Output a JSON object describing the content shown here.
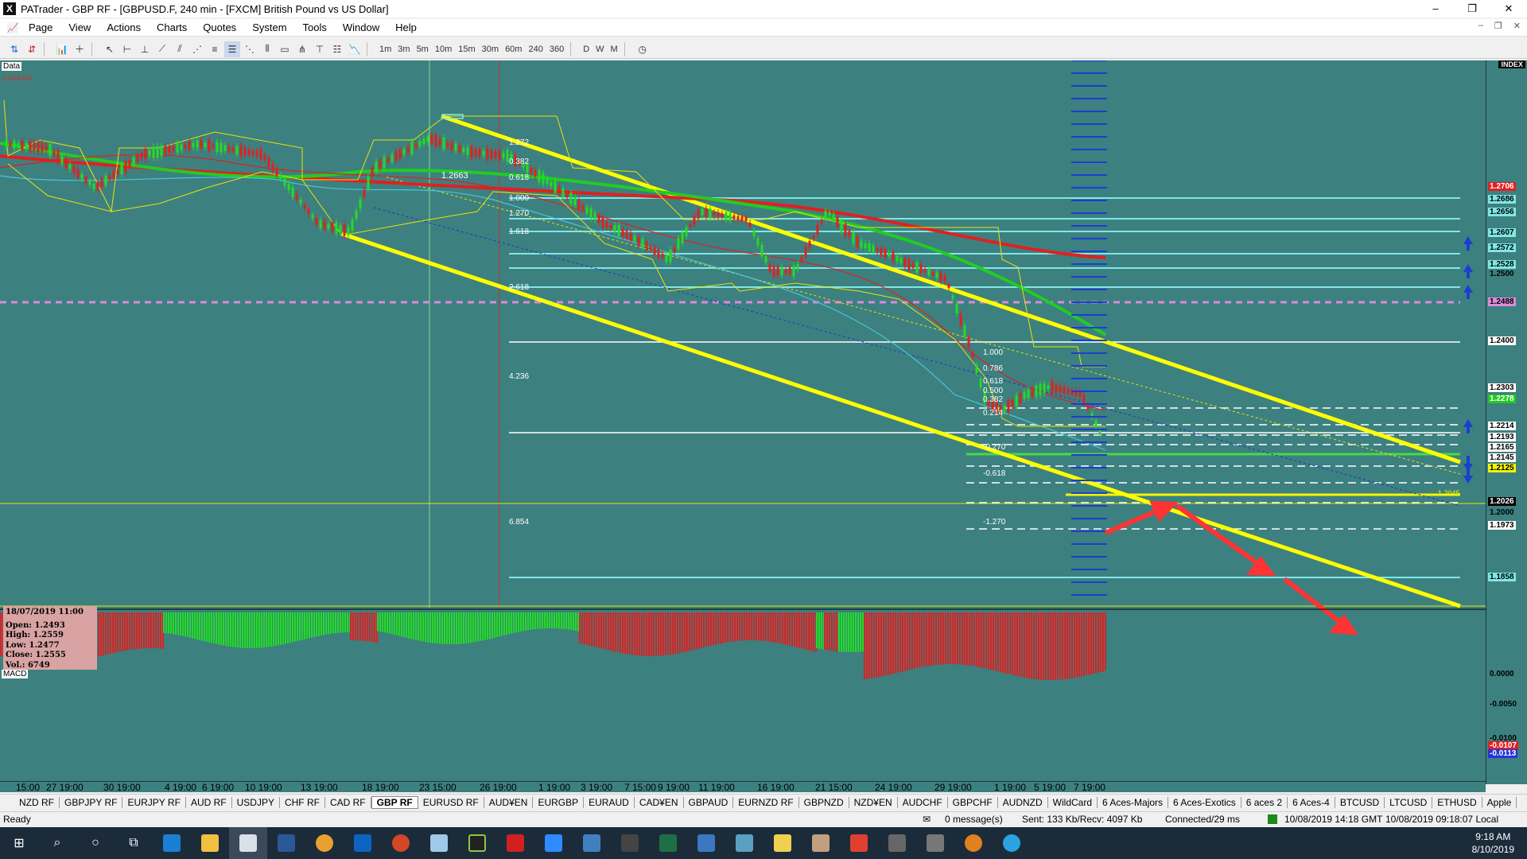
{
  "window": {
    "title": "PATrader - GBP RF - [GBPUSD.F, 240 min - [FXCM] British Pound vs US Dollar]",
    "app_icon": "X",
    "controls": [
      "–",
      "❐",
      "✕"
    ]
  },
  "menu": {
    "items": [
      "Page",
      "View",
      "Actions",
      "Charts",
      "Quotes",
      "System",
      "Tools",
      "Window",
      "Help"
    ],
    "mdi_controls": [
      "–",
      "❐",
      "✕"
    ]
  },
  "toolbar": {
    "timeframes": [
      "1m",
      "3m",
      "5m",
      "10m",
      "15m",
      "30m",
      "60m",
      "240",
      "360",
      "D",
      "W",
      "M"
    ]
  },
  "chart": {
    "data_label": "Data",
    "locked_label": "Locked",
    "index_label": "INDEX",
    "macd_label": "MACD",
    "swing_label": "1.2663",
    "small_price_tag": "1.2045",
    "fib_left": [
      "1.272",
      "0.382",
      "0.618",
      "1.000",
      "1.270",
      "1.618",
      "2.618",
      "4.236",
      "6.854"
    ],
    "fib_right": [
      "1.000",
      "0.786",
      "0.618",
      "0.500",
      "0.382",
      "0.214",
      "-0.270",
      "-0.618",
      "-1.270"
    ],
    "info_box": {
      "date": "18/07/2019 11:00",
      "open": "Open: 1.2493",
      "high": "High: 1.2559",
      "low": "Low: 1.2477",
      "close": "Close: 1.2555",
      "vol": "Vol.: 6749"
    },
    "price_labels": [
      {
        "text": "1.2706",
        "bg": "#e02020",
        "fg": "#ffffff"
      },
      {
        "text": "1.2686",
        "bg": "#7fe7e7",
        "fg": "#000000"
      },
      {
        "text": "1.2656",
        "bg": "#7fe7e7",
        "fg": "#000000"
      },
      {
        "text": "1.2607",
        "bg": "#7fe7e7",
        "fg": "#000000"
      },
      {
        "text": "1.2572",
        "bg": "#7fe7e7",
        "fg": "#000000"
      },
      {
        "text": "1.2528",
        "bg": "#7fe7e7",
        "fg": "#000000"
      },
      {
        "text": "1.2500",
        "bg": "#3d8080",
        "fg": "#000000"
      },
      {
        "text": "1.2488",
        "bg": "#d98cd9",
        "fg": "#000000"
      },
      {
        "text": "1.2400",
        "bg": "#ffffff",
        "fg": "#000000"
      },
      {
        "text": "1.2303",
        "bg": "#ffffff",
        "fg": "#000000"
      },
      {
        "text": "1.2278",
        "bg": "#22cc22",
        "fg": "#ffffff"
      },
      {
        "text": "1.2214",
        "bg": "#ffffff",
        "fg": "#000000"
      },
      {
        "text": "1.2193",
        "bg": "#ffffff",
        "fg": "#000000"
      },
      {
        "text": "1.2165",
        "bg": "#ffffff",
        "fg": "#000000"
      },
      {
        "text": "1.2145",
        "bg": "#ffffff",
        "fg": "#000000"
      },
      {
        "text": "1.2125",
        "bg": "#f5f500",
        "fg": "#000000"
      },
      {
        "text": "1.2026",
        "bg": "#000000",
        "fg": "#ffffff"
      },
      {
        "text": "1.2000",
        "bg": "#3d8080",
        "fg": "#000000"
      },
      {
        "text": "1.1973",
        "bg": "#ffffff",
        "fg": "#000000"
      },
      {
        "text": "1.1858",
        "bg": "#7fe7e7",
        "fg": "#000000"
      }
    ],
    "macd_labels": [
      {
        "text": "0.0000",
        "bg": "#3d8080",
        "fg": "#000000"
      },
      {
        "text": "-0.0050",
        "bg": "#3d8080",
        "fg": "#000000"
      },
      {
        "text": "-0.0100",
        "bg": "#3d8080",
        "fg": "#000000"
      },
      {
        "text": "-0.0107",
        "bg": "#e02020",
        "fg": "#ffffff"
      },
      {
        "text": "-0.0113",
        "bg": "#2233dd",
        "fg": "#ffffff"
      }
    ],
    "time_labels": [
      "15:00",
      "27 19:00",
      "30 19:00",
      "4 19:00",
      "6 19:00",
      "10 19:00",
      "13 19:00",
      "18 19:00",
      "23 15:00",
      "26 19:00",
      "1 19:00",
      "3 19:00",
      "7 15:00",
      "9 19:00",
      "11 19:00",
      "16 19:00",
      "21 15:00",
      "24 19:00",
      "29 19:00",
      "1 19:00",
      "5 19:00",
      "7 19:00"
    ],
    "colors": {
      "background": "#3d8080",
      "channel": "#ffff00",
      "red_ma": "#e02020",
      "green_ma": "#22cc22",
      "cyan_line": "#7fe7e7",
      "magenta_line": "#d98cd9",
      "arrow": "#ff3333"
    }
  },
  "tabs": [
    "NZD RF",
    "GBPJPY RF",
    "EURJPY RF",
    "AUD RF",
    "USDJPY",
    "CHF RF",
    "CAD RF",
    "GBP RF",
    "EURUSD RF",
    "AUD¥EN",
    "EURGBP",
    "EURAUD",
    "CAD¥EN",
    "GBPAUD",
    "EURNZD RF",
    "GBPNZD",
    "NZD¥EN",
    "AUDCHF",
    "GBPCHF",
    "AUDNZD",
    "WildCard",
    "6 Aces-Majors",
    "6 Aces-Exotics",
    "6 aces 2",
    "6 Aces-4",
    "BTCUSD",
    "LTCUSD",
    "ETHUSD",
    "Apple"
  ],
  "active_tab": "GBP RF",
  "status": {
    "ready": "Ready",
    "messages": "0 message(s)",
    "traffic": "Sent: 133 Kb/Recv: 4097 Kb",
    "connection": "Connected/29 ms",
    "gmt_time": "10/08/2019 14:18 GMT",
    "local_time": "10/08/2019 09:18:07 Local"
  },
  "taskbar": {
    "time": "9:18 AM",
    "date": "8/10/2019"
  }
}
